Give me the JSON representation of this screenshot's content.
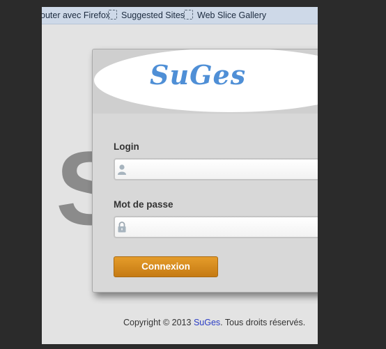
{
  "favorites_bar": {
    "items": [
      {
        "label": "outer avec Firefox"
      },
      {
        "label": "Suggested Sites",
        "icon": "favorite-page-icon"
      },
      {
        "label": "Web Slice Gallery",
        "icon": "favorite-page-icon"
      }
    ]
  },
  "background": {
    "letter": "S"
  },
  "login_panel": {
    "logo_text": "SuGes",
    "login_label": "Login",
    "login_value": "",
    "login_icon": "user-icon",
    "password_label": "Mot de passe",
    "password_value": "",
    "password_icon": "lock-icon",
    "submit_label": "Connexion"
  },
  "footer": {
    "prefix": "Copyright © 2013 ",
    "link_text": "SuGes",
    "suffix": ". Tous droits réservés."
  },
  "colors": {
    "accent_button": "#d88c1f",
    "logo_blue": "#4f8fd6",
    "link_blue": "#2a3cc4"
  }
}
